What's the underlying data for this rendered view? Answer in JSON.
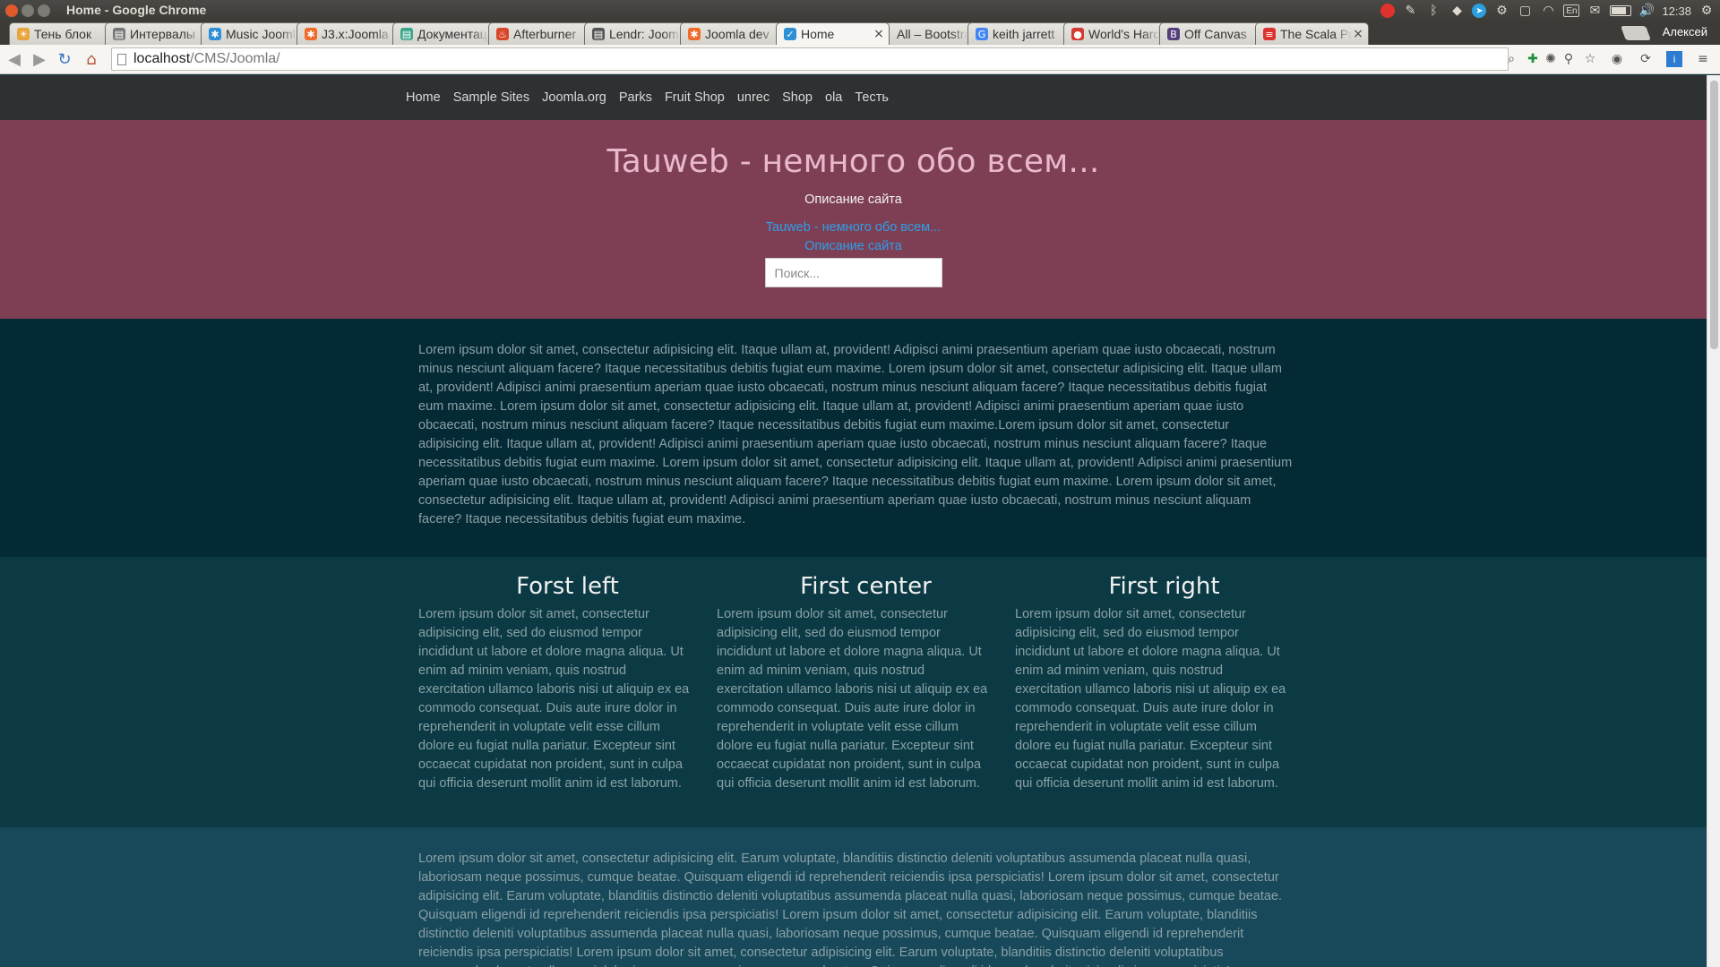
{
  "window": {
    "title": "Home - Google Chrome",
    "clock": "12:38",
    "tray_lang": "En"
  },
  "tabs": [
    {
      "label": "Тень блок",
      "favicon": "sun-icon",
      "color": "#e8a33a"
    },
    {
      "label": "Интервалы",
      "favicon": "doc-icon",
      "color": "#777777"
    },
    {
      "label": "Music Joomla",
      "favicon": "joomla-icon",
      "color": "#2d8fd5"
    },
    {
      "label": "J3.x:Joomla",
      "favicon": "joomla-icon",
      "color": "#f06a2a"
    },
    {
      "label": "Документация",
      "favicon": "doc-icon",
      "color": "#3aa689"
    },
    {
      "label": "Afterburner",
      "favicon": "flame-icon",
      "color": "#d9472b"
    },
    {
      "label": "Lendr: Joomla",
      "favicon": "doc-icon",
      "color": "#555555"
    },
    {
      "label": "Joomla dev",
      "favicon": "joomla-icon",
      "color": "#f06a2a"
    },
    {
      "label": "Home",
      "favicon": "check-icon",
      "color": "#2d8fd5",
      "active": true
    },
    {
      "label": "All – Bootstrap",
      "favicon": "none",
      "color": "#cccccc"
    },
    {
      "label": "keith jarrett",
      "favicon": "google-icon",
      "color": "#4285f4"
    },
    {
      "label": "World's Hardest",
      "favicon": "circle-icon",
      "color": "#d43a2f"
    },
    {
      "label": "Off Canvas",
      "favicon": "bootstrap-icon",
      "color": "#563d7c"
    },
    {
      "label": "The Scala Programming",
      "favicon": "scala-icon",
      "color": "#dc322f"
    }
  ],
  "profile_name": "Алексей",
  "toolbar": {
    "url_host": "localhost",
    "url_path": "/CMS/Joomla/"
  },
  "site": {
    "nav": [
      "Home",
      "Sample Sites",
      "Joomla.org",
      "Parks",
      "Fruit Shop",
      "unrec",
      "Shop",
      "ola",
      "Тесть"
    ],
    "title": "Tauweb - немного обо всем...",
    "description": "Описание сайта",
    "header_link_1": "Tauweb - немного обо всем...",
    "header_link_2": "Описание сайта",
    "search_placeholder": "Поиск...",
    "intro_text": "Lorem ipsum dolor sit amet, consectetur adipisicing elit. Itaque ullam at, provident! Adipisci animi praesentium aperiam quae iusto obcaecati, nostrum minus nesciunt aliquam facere? Itaque necessitatibus debitis fugiat eum maxime. Lorem ipsum dolor sit amet, consectetur adipisicing elit. Itaque ullam at, provident! Adipisci animi praesentium aperiam quae iusto obcaecati, nostrum minus nesciunt aliquam facere? Itaque necessitatibus debitis fugiat eum maxime. Lorem ipsum dolor sit amet, consectetur adipisicing elit. Itaque ullam at, provident! Adipisci animi praesentium aperiam quae iusto obcaecati, nostrum minus nesciunt aliquam facere? Itaque necessitatibus debitis fugiat eum maxime.Lorem ipsum dolor sit amet, consectetur adipisicing elit. Itaque ullam at, provident! Adipisci animi praesentium aperiam quae iusto obcaecati, nostrum minus nesciunt aliquam facere? Itaque necessitatibus debitis fugiat eum maxime. Lorem ipsum dolor sit amet, consectetur adipisicing elit. Itaque ullam at, provident! Adipisci animi praesentium aperiam quae iusto obcaecati, nostrum minus nesciunt aliquam facere? Itaque necessitatibus debitis fugiat eum maxime. Lorem ipsum dolor sit amet, consectetur adipisicing elit. Itaque ullam at, provident! Adipisci animi praesentium aperiam quae iusto obcaecati, nostrum minus nesciunt aliquam facere? Itaque necessitatibus debitis fugiat eum maxime.",
    "columns": [
      {
        "heading": "Forst left",
        "text": "Lorem ipsum dolor sit amet, consectetur adipisicing elit, sed do eiusmod tempor incididunt ut labore et dolore magna aliqua. Ut enim ad minim veniam, quis nostrud exercitation ullamco laboris nisi ut aliquip ex ea commodo consequat. Duis aute irure dolor in reprehenderit in voluptate velit esse cillum dolore eu fugiat nulla pariatur. Excepteur sint occaecat cupidatat non proident, sunt in culpa qui officia deserunt mollit anim id est laborum."
      },
      {
        "heading": "First center",
        "text": "Lorem ipsum dolor sit amet, consectetur adipisicing elit, sed do eiusmod tempor incididunt ut labore et dolore magna aliqua. Ut enim ad minim veniam, quis nostrud exercitation ullamco laboris nisi ut aliquip ex ea commodo consequat. Duis aute irure dolor in reprehenderit in voluptate velit esse cillum dolore eu fugiat nulla pariatur. Excepteur sint occaecat cupidatat non proident, sunt in culpa qui officia deserunt mollit anim id est laborum."
      },
      {
        "heading": "First right",
        "text": "Lorem ipsum dolor sit amet, consectetur adipisicing elit, sed do eiusmod tempor incididunt ut labore et dolore magna aliqua. Ut enim ad minim veniam, quis nostrud exercitation ullamco laboris nisi ut aliquip ex ea commodo consequat. Duis aute irure dolor in reprehenderit in voluptate velit esse cillum dolore eu fugiat nulla pariatur. Excepteur sint occaecat cupidatat non proident, sunt in culpa qui officia deserunt mollit anim id est laborum."
      }
    ],
    "bottom_text": "Lorem ipsum dolor sit amet, consectetur adipisicing elit. Earum voluptate, blanditiis distinctio deleniti voluptatibus assumenda placeat nulla quasi, laboriosam neque possimus, cumque beatae. Quisquam eligendi id reprehenderit reiciendis ipsa perspiciatis! Lorem ipsum dolor sit amet, consectetur adipisicing elit. Earum voluptate, blanditiis distinctio deleniti voluptatibus assumenda placeat nulla quasi, laboriosam neque possimus, cumque beatae. Quisquam eligendi id reprehenderit reiciendis ipsa perspiciatis! Lorem ipsum dolor sit amet, consectetur adipisicing elit. Earum voluptate, blanditiis distinctio deleniti voluptatibus assumenda placeat nulla quasi, laboriosam neque possimus, cumque beatae. Quisquam eligendi id reprehenderit reiciendis ipsa perspiciatis! Lorem ipsum dolor sit amet, consectetur adipisicing elit. Earum voluptate, blanditiis distinctio deleniti voluptatibus assumenda placeat nulla quasi, laboriosam neque possimus, cumque beatae. Quisquam eligendi id reprehenderit reiciendis ipsa perspiciatis!",
    "colors": {
      "nav_bg": "#2d3132",
      "header_bg": "#7e3f55",
      "title": "#e9b8cc",
      "link": "#2e9fe8",
      "intro_bg": "#042a35",
      "columns_bg": "#0b3a44",
      "bottom_bg": "#17495a"
    }
  }
}
